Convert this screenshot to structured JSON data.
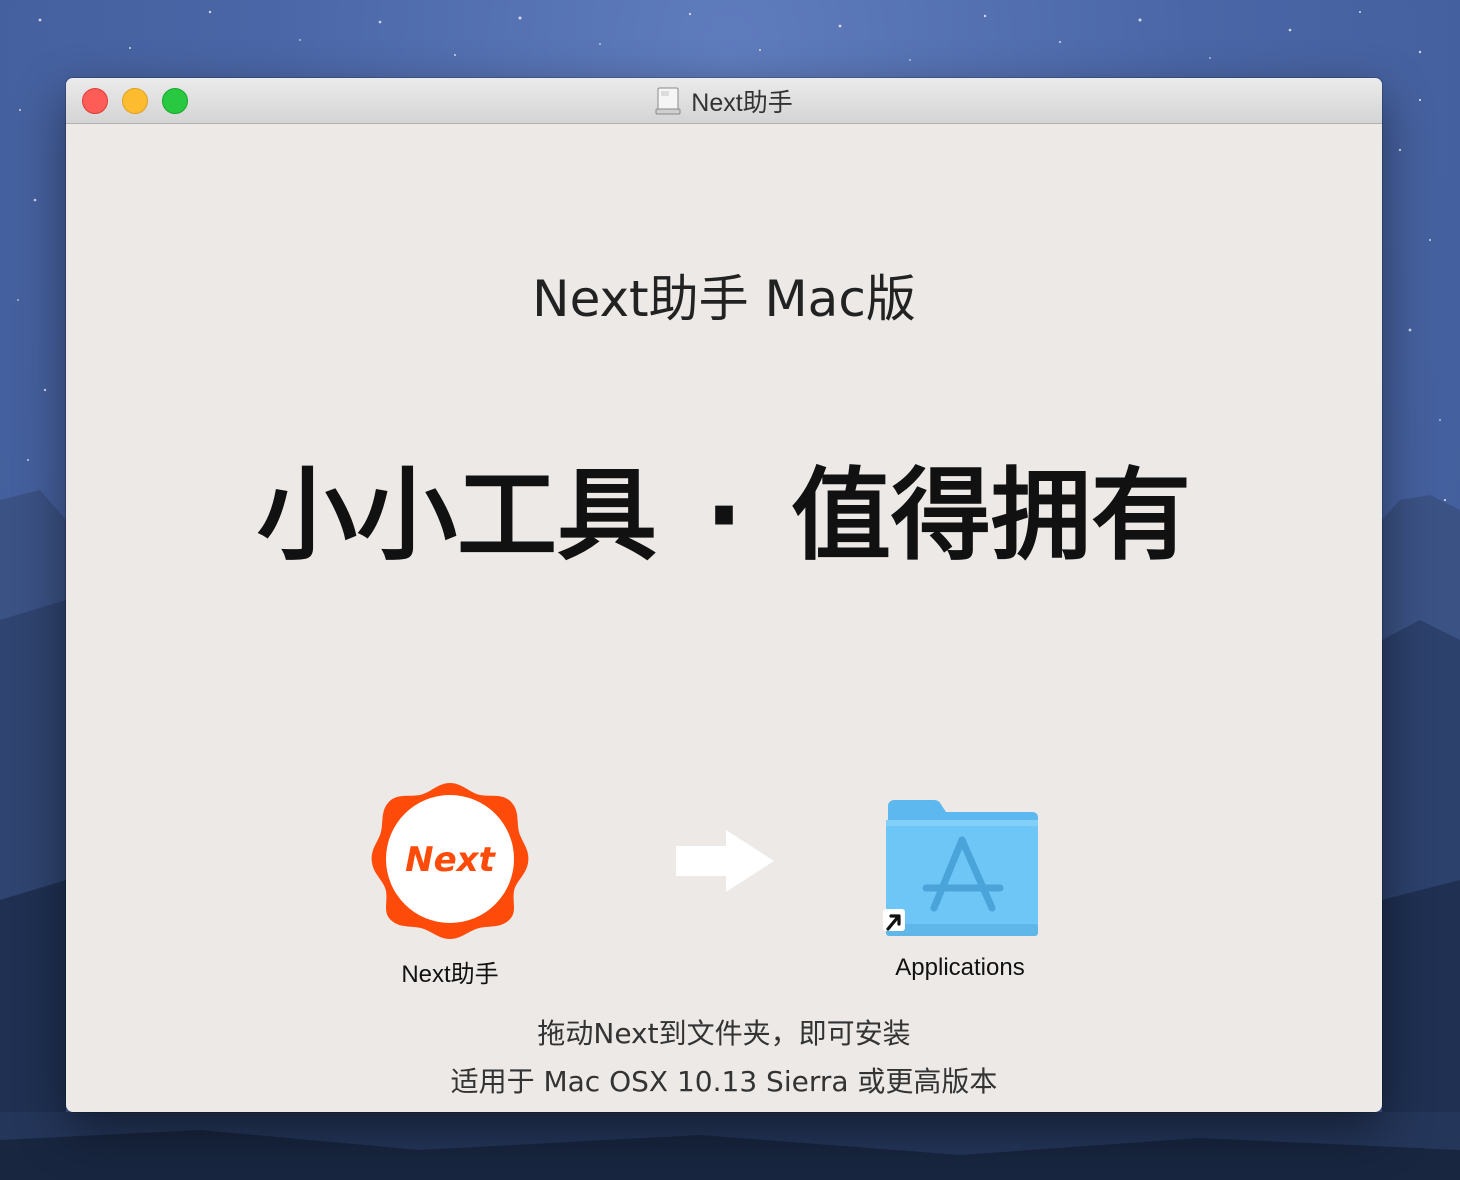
{
  "window": {
    "title": "Next助手",
    "controls": [
      "close",
      "minimize",
      "zoom"
    ],
    "title_icon": "disk-image-icon"
  },
  "installer": {
    "heading": "Next助手 Mac版",
    "slogan_left": "小小工具",
    "slogan_separator": "·",
    "slogan_right": "值得拥有",
    "app": {
      "icon": "next-app-icon",
      "icon_text": "Next",
      "label": "Next助手",
      "brand_color": "#ff4b0a"
    },
    "arrow_icon": "right-arrow-icon",
    "target": {
      "icon": "applications-folder-icon",
      "alias_icon": "alias-arrow-icon",
      "label": "Applications",
      "folder_color": "#6ec6f6"
    },
    "instruction": "拖动Next到文件夹，即可安装",
    "requirement": "适用于 Mac OSX 10.13 Sierra 或更高版本"
  }
}
